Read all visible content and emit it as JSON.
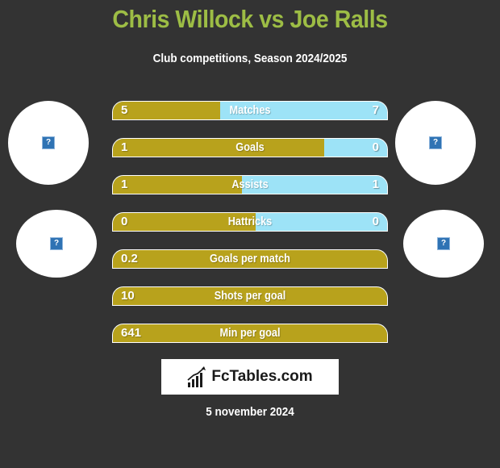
{
  "header": {
    "title": "Chris Willock vs Joe Ralls",
    "subtitle": "Club competitions, Season 2024/2025"
  },
  "players": {
    "left": {
      "name": "Chris Willock",
      "avatar_icon": "broken-image-icon",
      "club_icon": "broken-image-icon"
    },
    "right": {
      "name": "Joe Ralls",
      "avatar_icon": "broken-image-icon",
      "club_icon": "broken-image-icon"
    }
  },
  "colors": {
    "title": "#9dbd45",
    "left_bar": "#b8a21c",
    "right_bar": "#9de3f7",
    "background": "#333333"
  },
  "stats": [
    {
      "label": "Matches",
      "left": "5",
      "right": "7",
      "left_share": 0.39
    },
    {
      "label": "Goals",
      "left": "1",
      "right": "0",
      "left_share": 0.77
    },
    {
      "label": "Assists",
      "left": "1",
      "right": "1",
      "left_share": 0.47
    },
    {
      "label": "Hattricks",
      "left": "0",
      "right": "0",
      "left_share": 0.52
    },
    {
      "label": "Goals per match",
      "left": "0.2",
      "right": null,
      "left_share": 1.0
    },
    {
      "label": "Shots per goal",
      "left": "10",
      "right": null,
      "left_share": 1.0
    },
    {
      "label": "Min per goal",
      "left": "641",
      "right": null,
      "left_share": 1.0
    }
  ],
  "footer": {
    "logo_text": "FcTables.com",
    "logo_icon": "bar-chart-icon",
    "date": "5 november 2024"
  }
}
